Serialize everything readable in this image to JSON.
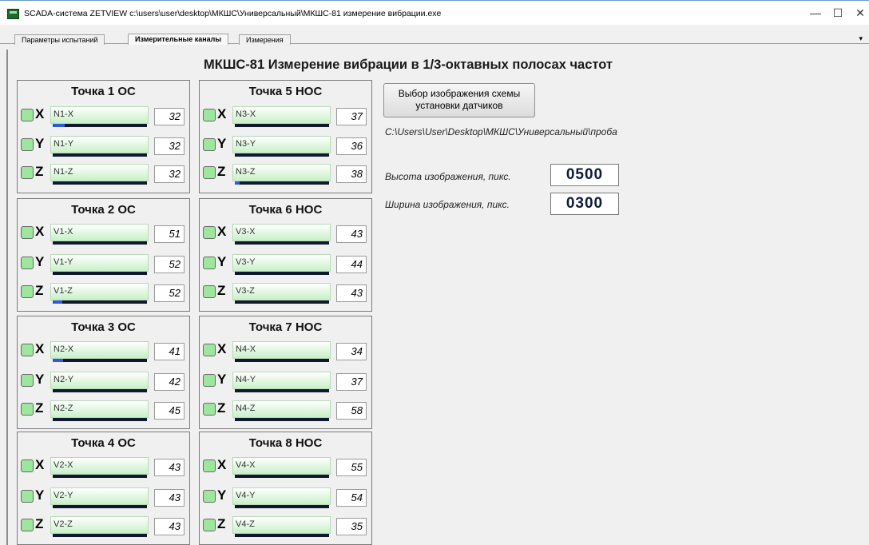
{
  "window": {
    "title": "SCADA-система ZETVIEW c:\\users\\user\\desktop\\МКШС\\Универсальный\\МКШС-81 измерение вибрации.exe",
    "minimize": "—",
    "maximize": "☐",
    "close": "✕"
  },
  "tabs": [
    {
      "label": "Параметры испытаний"
    },
    {
      "label": "Измерительные каналы"
    },
    {
      "label": "Измерения"
    }
  ],
  "tab_menu_arrow": "▾",
  "main_title": "МКШС-81 Измерение вибрации в 1/3-октавных полосах частот",
  "panels": [
    {
      "title": "Точка 1 ОС",
      "channels": [
        {
          "axis": "X",
          "label": "N1-X",
          "value": "32",
          "level": 0.13
        },
        {
          "axis": "Y",
          "label": "N1-Y",
          "value": "32",
          "level": 0.0
        },
        {
          "axis": "Z",
          "label": "N1-Z",
          "value": "32",
          "level": 0.0
        }
      ]
    },
    {
      "title": "Точка 2 ОС",
      "channels": [
        {
          "axis": "X",
          "label": "V1-X",
          "value": "51",
          "level": 0.0
        },
        {
          "axis": "Y",
          "label": "V1-Y",
          "value": "52",
          "level": 0.0
        },
        {
          "axis": "Z",
          "label": "V1-Z",
          "value": "52",
          "level": 0.1
        }
      ]
    },
    {
      "title": "Точка 3 ОС",
      "channels": [
        {
          "axis": "X",
          "label": "N2-X",
          "value": "41",
          "level": 0.11
        },
        {
          "axis": "Y",
          "label": "N2-Y",
          "value": "42",
          "level": 0.0
        },
        {
          "axis": "Z",
          "label": "N2-Z",
          "value": "45",
          "level": 0.0
        }
      ]
    },
    {
      "title": "Точка 4 ОС",
      "channels": [
        {
          "axis": "X",
          "label": "V2-X",
          "value": "43",
          "level": 0.0
        },
        {
          "axis": "Y",
          "label": "V2-Y",
          "value": "43",
          "level": 0.0
        },
        {
          "axis": "Z",
          "label": "V2-Z",
          "value": "43",
          "level": 0.0
        }
      ]
    },
    {
      "title": "Точка 5 НОС",
      "channels": [
        {
          "axis": "X",
          "label": "N3-X",
          "value": "37",
          "level": 0.0
        },
        {
          "axis": "Y",
          "label": "N3-Y",
          "value": "36",
          "level": 0.0
        },
        {
          "axis": "Z",
          "label": "N3-Z",
          "value": "38",
          "level": 0.05
        }
      ]
    },
    {
      "title": "Точка 6 НОС",
      "channels": [
        {
          "axis": "X",
          "label": "V3-X",
          "value": "43",
          "level": 0.0
        },
        {
          "axis": "Y",
          "label": "V3-Y",
          "value": "44",
          "level": 0.0
        },
        {
          "axis": "Z",
          "label": "V3-Z",
          "value": "43",
          "level": 0.0
        }
      ]
    },
    {
      "title": "Точка 7 НОС",
      "channels": [
        {
          "axis": "X",
          "label": "N4-X",
          "value": "34",
          "level": 0.0
        },
        {
          "axis": "Y",
          "label": "N4-Y",
          "value": "37",
          "level": 0.0
        },
        {
          "axis": "Z",
          "label": "N4-Z",
          "value": "58",
          "level": 0.0
        }
      ]
    },
    {
      "title": "Точка 8 НОС",
      "channels": [
        {
          "axis": "X",
          "label": "V4-X",
          "value": "55",
          "level": 0.0
        },
        {
          "axis": "Y",
          "label": "V4-Y",
          "value": "54",
          "level": 0.0
        },
        {
          "axis": "Z",
          "label": "V4-Z",
          "value": "35",
          "level": 0.0
        }
      ]
    }
  ],
  "image_button": "Выбор изображения схемы установки датчиков",
  "image_path": "C:\\Users\\User\\Desktop\\МКШС\\Универсальный\\проба",
  "height_label": "Высота изображения, пикс.",
  "height_value": "0500",
  "width_label": "Ширина изображения, пикс.",
  "width_value": "0300",
  "colors": {
    "led": "#9ee59e",
    "bar_track": "#10182e",
    "bar_fill": "#2d5cd6",
    "value_text": "#0f1a3a"
  }
}
